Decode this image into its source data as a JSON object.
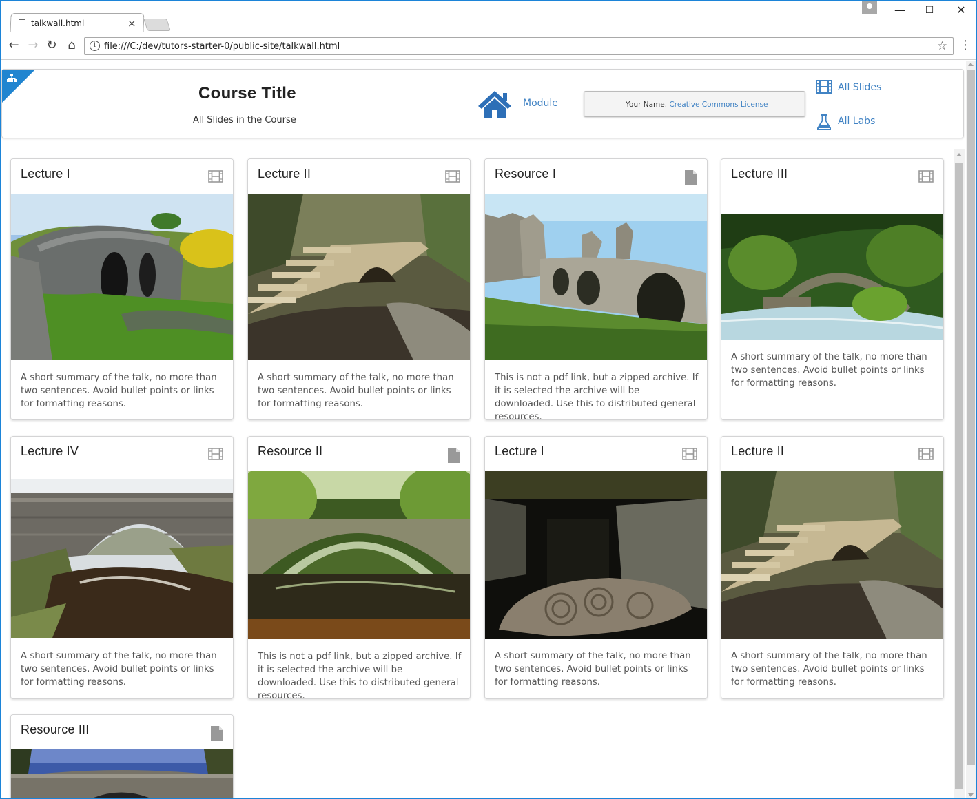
{
  "browser": {
    "tab_title": "talkwall.html",
    "url": "file:///C:/dev/tutors-starter-0/public-site/talkwall.html"
  },
  "header": {
    "course_title": "Course Title",
    "course_subtitle": "All Slides in the Course",
    "module_link": "Module",
    "license_name": "Your Name.",
    "license_link": "Creative Commons License",
    "all_slides": "All Slides",
    "all_labs": "All Labs"
  },
  "cards": [
    {
      "title": "Lecture I",
      "type": "film-icon",
      "desc": "A short summary of the talk, no more than two sentences. Avoid bullet points or links for formatting reasons."
    },
    {
      "title": "Lecture II",
      "type": "film-icon",
      "desc": "A short summary of the talk, no more than two sentences. Avoid bullet points or links for formatting reasons."
    },
    {
      "title": "Resource I",
      "type": "document-icon",
      "desc": "This is not a pdf link, but a zipped archive. If it is selected the archive will be downloaded. Use this to distributed general resources."
    },
    {
      "title": "Lecture III",
      "type": "film-icon",
      "desc": "A short summary of the talk, no more than two sentences. Avoid bullet points or links for formatting reasons."
    },
    {
      "title": "Lecture IV",
      "type": "film-icon",
      "desc": "A short summary of the talk, no more than two sentences. Avoid bullet points or links for formatting reasons."
    },
    {
      "title": "Resource II",
      "type": "document-icon",
      "desc": "This is not a pdf link, but a zipped archive. If it is selected the archive will be downloaded. Use this to distributed general resources."
    },
    {
      "title": "Lecture I",
      "type": "film-icon",
      "desc": "A short summary of the talk, no more than two sentences. Avoid bullet points or links for formatting reasons."
    },
    {
      "title": "Lecture II",
      "type": "film-icon",
      "desc": "A short summary of the talk, no more than two sentences. Avoid bullet points or links for formatting reasons."
    },
    {
      "title": "Resource III",
      "type": "document-icon",
      "desc": ""
    }
  ],
  "colors": {
    "accent": "#2185d0",
    "link": "#4183c4",
    "home_icon": "#2d6fb7"
  }
}
